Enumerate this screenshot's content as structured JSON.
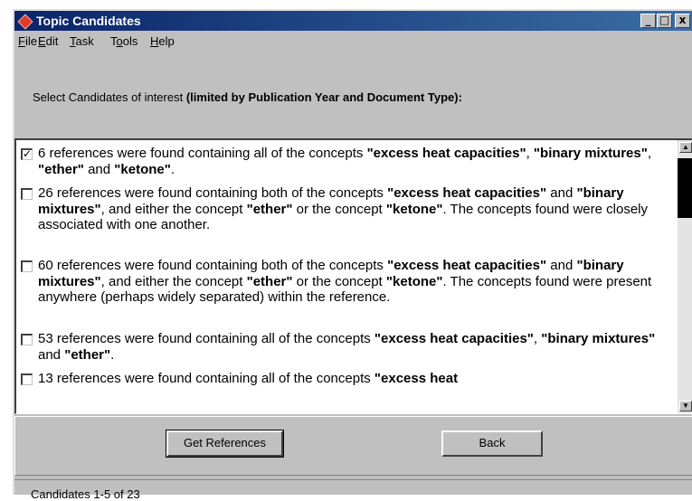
{
  "window": {
    "title": "Topic Candidates",
    "controls": {
      "minimize": "_",
      "maximize": "□",
      "close": "x"
    }
  },
  "menu": [
    {
      "prefix": "",
      "accel": "F",
      "rest": "ile"
    },
    {
      "prefix": "",
      "accel": "E",
      "rest": "dit"
    },
    {
      "prefix": "",
      "accel": "T",
      "rest": "ask"
    },
    {
      "prefix": "T",
      "accel": "o",
      "rest": "ols"
    },
    {
      "prefix": "",
      "accel": "H",
      "rest": "elp"
    }
  ],
  "instruction": {
    "text": "Select Candidates of interest ",
    "bold": "(limited by Publication Year and  Document Type):"
  },
  "candidates": [
    {
      "checked": true,
      "check_mark": "✓",
      "segments": [
        {
          "t": "6 references were found containing all of the concepts ",
          "b": false
        },
        {
          "t": "\"excess heat capacities\"",
          "b": true
        },
        {
          "t": ", ",
          "b": false
        },
        {
          "t": "\"binary mixtures\"",
          "b": true
        },
        {
          "t": ", ",
          "b": false
        },
        {
          "t": "\"ether\"",
          "b": true
        },
        {
          "t": " and ",
          "b": false
        },
        {
          "t": "\"ketone\"",
          "b": true
        },
        {
          "t": ".",
          "b": false
        }
      ]
    },
    {
      "checked": false,
      "check_mark": "",
      "segments": [
        {
          "t": "26 references were found containing both of the concepts ",
          "b": false
        },
        {
          "t": "\"excess heat capacities\"",
          "b": true
        },
        {
          "t": " and ",
          "b": false
        },
        {
          "t": "\"binary mixtures\"",
          "b": true
        },
        {
          "t": ", and either the concept ",
          "b": false
        },
        {
          "t": "\"ether\"",
          "b": true
        },
        {
          "t": " or the concept ",
          "b": false
        },
        {
          "t": "\"ketone\"",
          "b": true
        },
        {
          "t": ". The concepts found were closely associated with one another.",
          "b": false
        }
      ]
    },
    {
      "checked": false,
      "check_mark": "",
      "segments": [
        {
          "t": "60 references were found containing both of the concepts ",
          "b": false
        },
        {
          "t": "\"excess heat capacities\"",
          "b": true
        },
        {
          "t": " and ",
          "b": false
        },
        {
          "t": "\"binary mixtures\"",
          "b": true
        },
        {
          "t": ", and either the concept ",
          "b": false
        },
        {
          "t": "\"ether\"",
          "b": true
        },
        {
          "t": " or the concept ",
          "b": false
        },
        {
          "t": "\"ketone\"",
          "b": true
        },
        {
          "t": ". The concepts found were present anywhere (perhaps widely separated) within the reference.",
          "b": false
        }
      ]
    },
    {
      "checked": false,
      "check_mark": "",
      "segments": [
        {
          "t": "53 references were found containing all of the concepts ",
          "b": false
        },
        {
          "t": "\"excess heat capacities\"",
          "b": true
        },
        {
          "t": ", ",
          "b": false
        },
        {
          "t": "\"binary mixtures\"",
          "b": true
        },
        {
          "t": " and ",
          "b": false
        },
        {
          "t": "\"ether\"",
          "b": true
        },
        {
          "t": ".",
          "b": false
        }
      ]
    },
    {
      "checked": false,
      "check_mark": "",
      "segments": [
        {
          "t": "13 references were found containing all of the concepts ",
          "b": false
        },
        {
          "t": "\"excess heat",
          "b": true
        }
      ]
    }
  ],
  "scrollbar": {
    "up_arrow": "▲",
    "down_arrow": "▼"
  },
  "buttons": {
    "get_references": "Get References",
    "back": "Back"
  },
  "status": "Candidates 1-5 of 23"
}
